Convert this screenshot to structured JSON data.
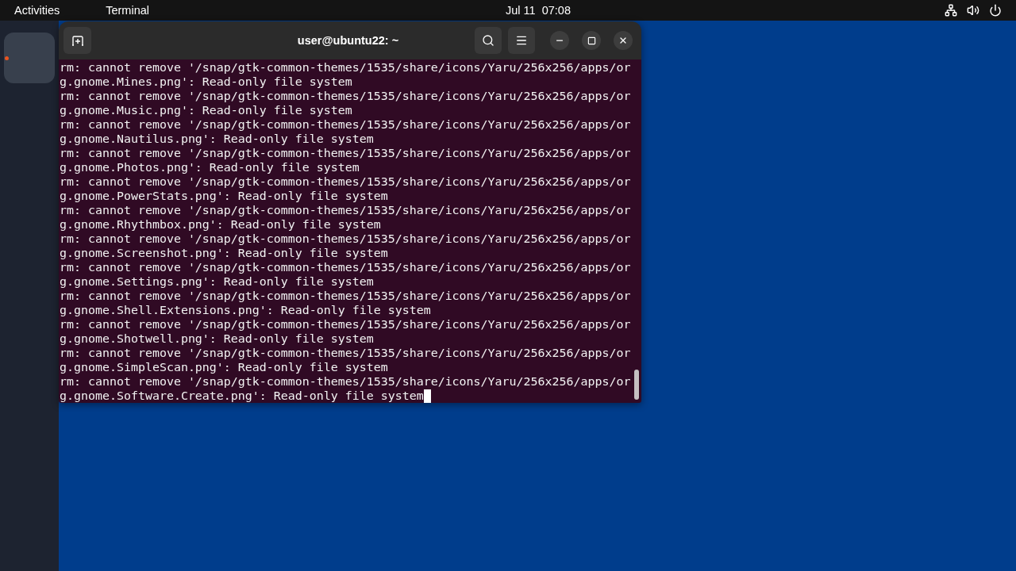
{
  "top_bar": {
    "activities": "Activities",
    "app_menu": "Terminal",
    "clock": "Jul 11  07:08"
  },
  "dock": {
    "items": [
      {
        "running": true
      }
    ]
  },
  "terminal_window": {
    "title": "user@ubuntu22: ~",
    "cursor": true,
    "lines": [
      "rm: cannot remove '/snap/gtk-common-themes/1535/share/icons/Yaru/256x256/apps/org.gnome.Mines.png': Read-only file system",
      "rm: cannot remove '/snap/gtk-common-themes/1535/share/icons/Yaru/256x256/apps/org.gnome.Music.png': Read-only file system",
      "rm: cannot remove '/snap/gtk-common-themes/1535/share/icons/Yaru/256x256/apps/org.gnome.Nautilus.png': Read-only file system",
      "rm: cannot remove '/snap/gtk-common-themes/1535/share/icons/Yaru/256x256/apps/org.gnome.Photos.png': Read-only file system",
      "rm: cannot remove '/snap/gtk-common-themes/1535/share/icons/Yaru/256x256/apps/org.gnome.PowerStats.png': Read-only file system",
      "rm: cannot remove '/snap/gtk-common-themes/1535/share/icons/Yaru/256x256/apps/org.gnome.Rhythmbox.png': Read-only file system",
      "rm: cannot remove '/snap/gtk-common-themes/1535/share/icons/Yaru/256x256/apps/org.gnome.Screenshot.png': Read-only file system",
      "rm: cannot remove '/snap/gtk-common-themes/1535/share/icons/Yaru/256x256/apps/org.gnome.Settings.png': Read-only file system",
      "rm: cannot remove '/snap/gtk-common-themes/1535/share/icons/Yaru/256x256/apps/org.gnome.Shell.Extensions.png': Read-only file system",
      "rm: cannot remove '/snap/gtk-common-themes/1535/share/icons/Yaru/256x256/apps/org.gnome.Shotwell.png': Read-only file system",
      "rm: cannot remove '/snap/gtk-common-themes/1535/share/icons/Yaru/256x256/apps/org.gnome.SimpleScan.png': Read-only file system",
      "rm: cannot remove '/snap/gtk-common-themes/1535/share/icons/Yaru/256x256/apps/org.gnome.Software.Create.png': Read-only file system"
    ]
  }
}
